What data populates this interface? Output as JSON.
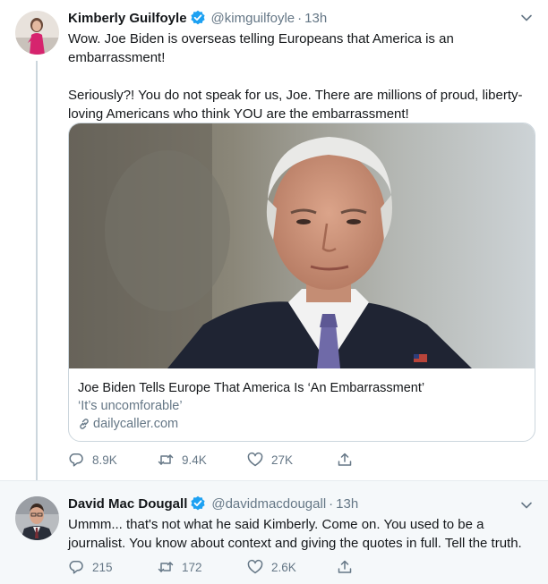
{
  "tweets": [
    {
      "author_name": "Kimberly Guilfoyle",
      "handle": "@kimguilfoyle",
      "separator": "·",
      "time": "13h",
      "paragraphs": [
        "Wow. Joe Biden is overseas telling Europeans that America is an embarrassment!",
        "Seriously?! You do not speak for us, Joe. There are millions of proud, liberty-loving Americans who think YOU are the embarrassment!"
      ],
      "card": {
        "title": "Joe Biden Tells Europe That America Is ‘An Embarrassment’",
        "description": "‘It’s uncomforable’",
        "domain": "dailycaller.com",
        "image_icon": "photo-of-joe-biden"
      },
      "actions": {
        "replies": "8.9K",
        "retweets": "9.4K",
        "likes": "27K"
      }
    },
    {
      "author_name": "David Mac Dougall",
      "handle": "@davidmacdougall",
      "separator": "·",
      "time": "13h",
      "text": "Ummm... that's not what he said Kimberly. Come on. You used to be a journalist. You know about context and giving the quotes in full. Tell the truth.",
      "actions": {
        "replies": "215",
        "retweets": "172",
        "likes": "2.6K"
      }
    }
  ],
  "icons": [
    "verified-icon",
    "chevron-down-icon",
    "reply-icon",
    "retweet-icon",
    "like-icon",
    "share-icon",
    "link-icon"
  ],
  "colors": {
    "verified": "#1da1f2",
    "secondary_text": "#657786",
    "border": "#ccd6dd",
    "reply_background": "#f5f8fa"
  }
}
